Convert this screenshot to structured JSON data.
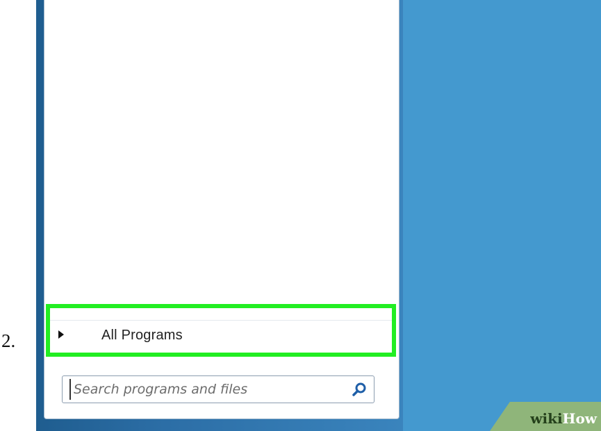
{
  "step": {
    "number": "2."
  },
  "start_menu": {
    "all_programs": {
      "label": "All Programs",
      "icon": "triangle-right-icon"
    },
    "search": {
      "placeholder": "Search programs and files",
      "value": "",
      "icon": "search-icon"
    }
  },
  "highlight": {
    "color": "#22ee22"
  },
  "desktop": {
    "background_color": "#4499cf"
  },
  "watermark": {
    "part1": "wiki",
    "part2": "How"
  }
}
